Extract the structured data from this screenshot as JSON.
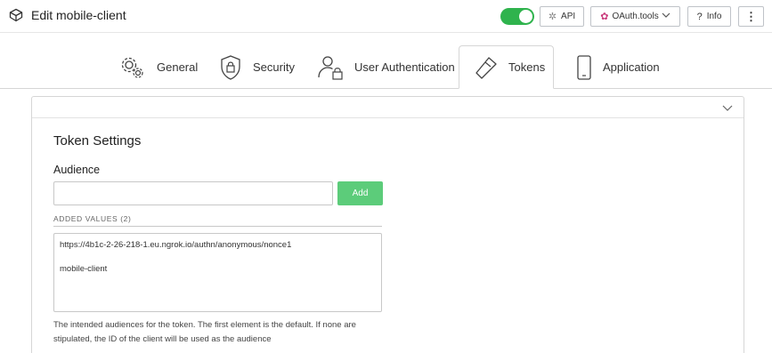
{
  "header": {
    "title": "Edit mobile-client",
    "title_icon": "cube-icon",
    "enabled": true,
    "buttons": {
      "api_label": "API",
      "oauth_label": "OAuth.tools",
      "info_label": "Info",
      "more_label": "⋮"
    }
  },
  "tabs": [
    {
      "label": "General",
      "icon": "gears-icon",
      "active": false
    },
    {
      "label": "Security",
      "icon": "shield-lock-icon",
      "active": false
    },
    {
      "label": "User Authentication",
      "icon": "user-lock-icon",
      "active": false
    },
    {
      "label": "Tokens",
      "icon": "ticket-icon",
      "active": true
    },
    {
      "label": "Application",
      "icon": "phone-icon",
      "active": false
    }
  ],
  "token_settings": {
    "title": "Token Settings",
    "audience_label": "Audience",
    "audience_value": "",
    "add_label": "Add",
    "added_values_label": "ADDED VALUES (2)",
    "values": [
      "https://4b1c-2-26-218-1.eu.ngrok.io/authn/anonymous/nonce1",
      "mobile-client"
    ],
    "help_text": "The intended audiences for the token. The first element is the default. If none are stipulated, the ID of the client will be used as the audience"
  },
  "colors": {
    "toggle_on": "#2fb34d",
    "add_button": "#5ccc7a",
    "oauth_icon": "#c9387a"
  }
}
